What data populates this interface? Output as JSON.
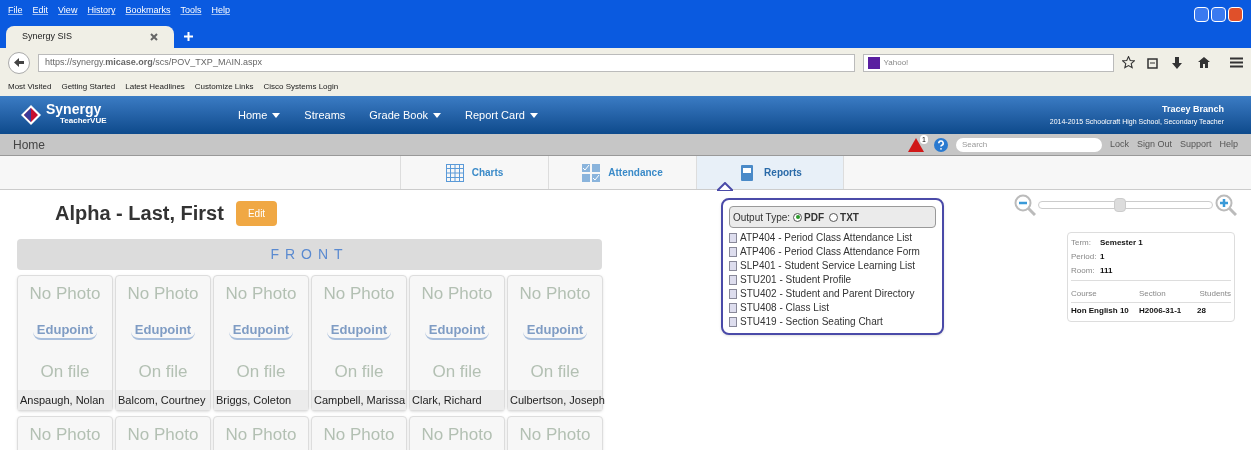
{
  "browser": {
    "menu": [
      "File",
      "Edit",
      "View",
      "History",
      "Bookmarks",
      "Tools",
      "Help"
    ],
    "tab": {
      "title": "Synergy SIS"
    },
    "url": "https://synergy.**micase.org**/scs/POV_TXP_MAIN.aspx",
    "search": {
      "placeholder": "Yahoo!"
    },
    "bookmarks": [
      "Most Visited",
      "Getting Started",
      "Latest Headlines",
      "Customize Links",
      "Cisco Systems Login"
    ]
  },
  "app": {
    "logo": {
      "name": "Synergy",
      "sub": "TeacherVUE"
    },
    "nav": [
      {
        "label": "Home",
        "dropdown": true
      },
      {
        "label": "Streams",
        "dropdown": false
      },
      {
        "label": "Grade Book",
        "dropdown": true
      },
      {
        "label": "Report Card",
        "dropdown": true
      }
    ],
    "user": {
      "name": "Tracey Branch",
      "role": "2014-2015 Schoolcraft High School, Secondary Teacher"
    },
    "breadcrumb": "Home",
    "alert_count": "1",
    "search": {
      "placeholder": "Search"
    },
    "links": [
      "Lock",
      "Sign Out",
      "Support",
      "Help"
    ],
    "tools": [
      {
        "label": "Charts",
        "selected": false
      },
      {
        "label": "Attendance",
        "selected": false
      },
      {
        "label": "Reports",
        "selected": true
      }
    ]
  },
  "reports_menu": {
    "output_label": "Output Type:",
    "output_types": [
      {
        "label": "PDF",
        "selected": true
      },
      {
        "label": "TXT",
        "selected": false
      }
    ],
    "reports": [
      "ATP404 - Period Class Attendance List",
      "ATP406 - Period Class Attendance Form",
      "SLP401 - Student Service Learning List",
      "STU201 - Student Profile",
      "STU402 - Student and Parent Directory",
      "STU408 - Class List",
      "STU419 - Section Seating Chart"
    ]
  },
  "seating": {
    "title": "Alpha - Last, First",
    "edit": "Edit",
    "front": "FRONT",
    "rows": [
      [
        {
          "photo": [
            "No Photo",
            "Edu",
            "point",
            "On file"
          ],
          "name": "Anspaugh, Nolan"
        },
        {
          "photo": [
            "No Photo",
            "Edu",
            "point",
            "On file"
          ],
          "name": "Balcom, Courtney"
        },
        {
          "photo": [
            "No Photo",
            "Edu",
            "point",
            "On file"
          ],
          "name": "Briggs, Coleton"
        },
        {
          "photo": [
            "No Photo",
            "Edu",
            "point",
            "On file"
          ],
          "name": "Campbell, Marissa"
        },
        {
          "photo": [
            "No Photo",
            "Edu",
            "point",
            "On file"
          ],
          "name": "Clark, Richard"
        },
        {
          "photo": [
            "No Photo",
            "Edu",
            "point",
            "On file"
          ],
          "name": "Culbertson, Joseph"
        }
      ],
      [
        {
          "photo": [
            "No Photo"
          ]
        },
        {
          "photo": [
            "No Photo"
          ]
        },
        {
          "photo": [
            "No Photo"
          ]
        },
        {
          "photo": [
            "No Photo"
          ]
        },
        {
          "photo": [
            "No Photo"
          ]
        },
        {
          "photo": [
            "No Photo"
          ]
        }
      ]
    ]
  },
  "zoom": {
    "level": 0.47
  },
  "class_info": {
    "fields": [
      {
        "label": "Term:",
        "value": "Semester 1"
      },
      {
        "label": "Period:",
        "value": "1"
      },
      {
        "label": "Room:",
        "value": "111"
      }
    ],
    "columns": [
      "Course",
      "Section",
      "Students"
    ],
    "row": [
      "Hon English 10",
      "H2006-31-1",
      "28"
    ]
  }
}
